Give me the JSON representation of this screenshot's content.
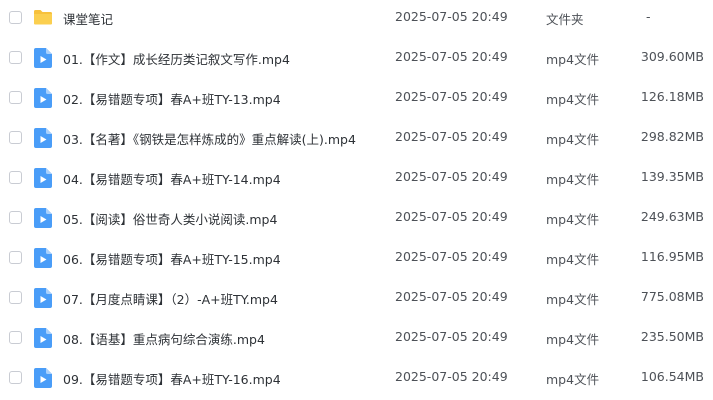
{
  "files": [
    {
      "name": "课堂笔记",
      "date": "2025-07-05 20:49",
      "type": "文件夹",
      "size": "-",
      "icon": "folder-icon"
    },
    {
      "name": "01.【作文】成长经历类记叙文写作.mp4",
      "date": "2025-07-05 20:49",
      "type": "mp4文件",
      "size": "309.60MB",
      "icon": "video-file-icon"
    },
    {
      "name": "02.【易错题专项】春A+班TY-13.mp4",
      "date": "2025-07-05 20:49",
      "type": "mp4文件",
      "size": "126.18MB",
      "icon": "video-file-icon"
    },
    {
      "name": "03.【名著】《钢铁是怎样炼成的》重点解读(上).mp4",
      "date": "2025-07-05 20:49",
      "type": "mp4文件",
      "size": "298.82MB",
      "icon": "video-file-icon"
    },
    {
      "name": "04.【易错题专项】春A+班TY-14.mp4",
      "date": "2025-07-05 20:49",
      "type": "mp4文件",
      "size": "139.35MB",
      "icon": "video-file-icon"
    },
    {
      "name": "05.【阅读】俗世奇人类小说阅读.mp4",
      "date": "2025-07-05 20:49",
      "type": "mp4文件",
      "size": "249.63MB",
      "icon": "video-file-icon"
    },
    {
      "name": "06.【易错题专项】春A+班TY-15.mp4",
      "date": "2025-07-05 20:49",
      "type": "mp4文件",
      "size": "116.95MB",
      "icon": "video-file-icon"
    },
    {
      "name": "07.【月度点睛课】（2）-A+班TY.mp4",
      "date": "2025-07-05 20:49",
      "type": "mp4文件",
      "size": "775.08MB",
      "icon": "video-file-icon"
    },
    {
      "name": "08.【语基】重点病句综合演练.mp4",
      "date": "2025-07-05 20:49",
      "type": "mp4文件",
      "size": "235.50MB",
      "icon": "video-file-icon"
    },
    {
      "name": "09.【易错题专项】春A+班TY-16.mp4",
      "date": "2025-07-05 20:49",
      "type": "mp4文件",
      "size": "106.54MB",
      "icon": "video-file-icon"
    }
  ],
  "colors": {
    "folder": "#f7c13c",
    "video": "#4a9df8"
  }
}
